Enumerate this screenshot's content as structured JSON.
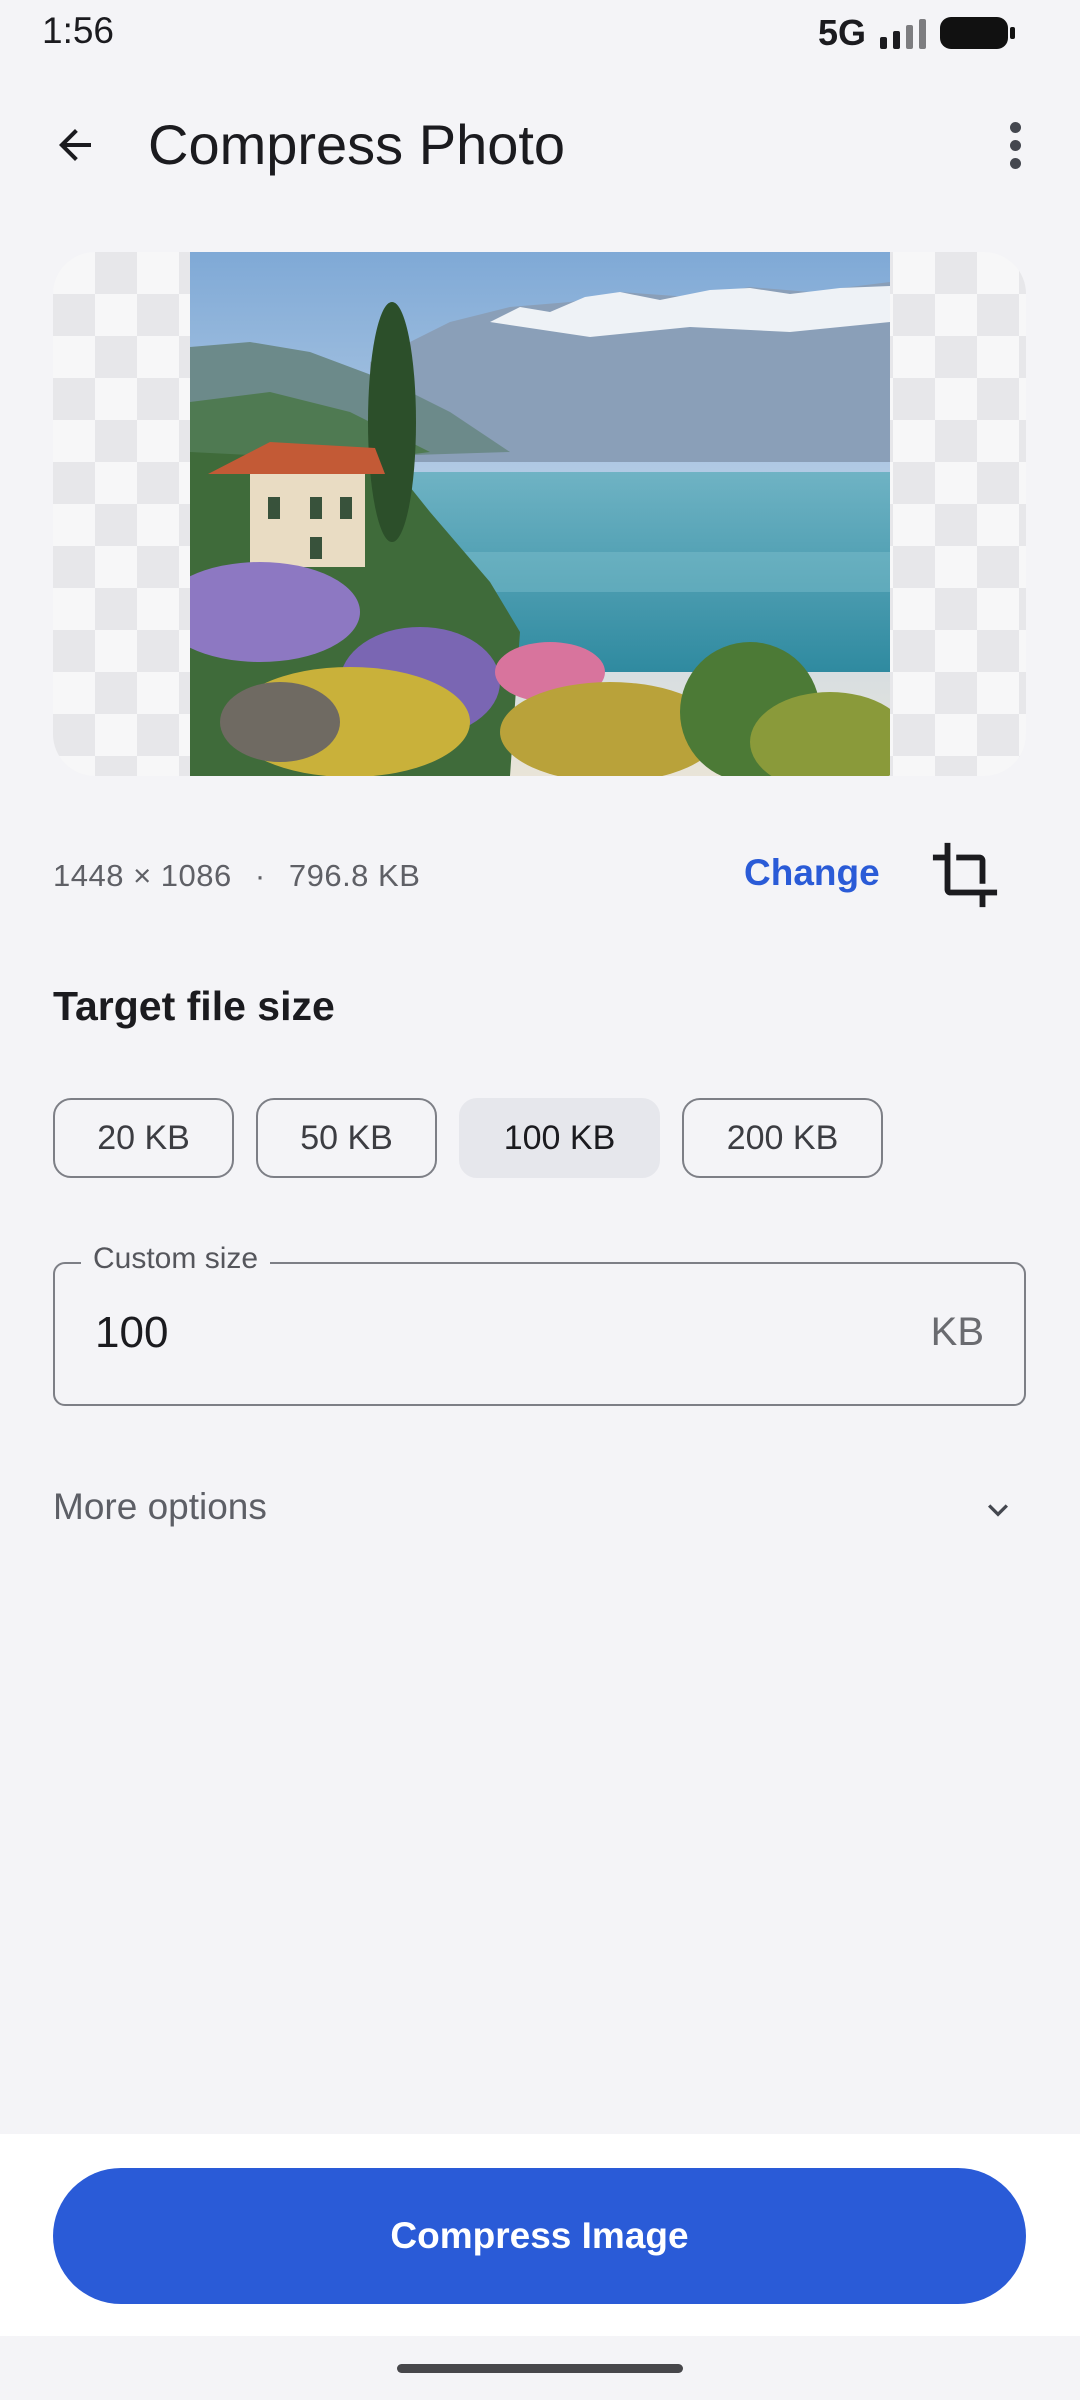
{
  "status_bar": {
    "time": "1:56",
    "network": "5G"
  },
  "app_bar": {
    "title": "Compress Photo",
    "back_icon": "arrow-back-icon",
    "menu_icon": "more-vert-icon"
  },
  "image_info": {
    "dimensions": "1448 × 1086",
    "separator": "·",
    "size": "796.8 KB",
    "change_label": "Change",
    "crop_icon": "crop-icon"
  },
  "target": {
    "title": "Target file size",
    "presets": [
      {
        "label": "20 KB",
        "selected": false
      },
      {
        "label": "50 KB",
        "selected": false
      },
      {
        "label": "100 KB",
        "selected": true
      },
      {
        "label": "200 KB",
        "selected": false
      }
    ]
  },
  "custom_size": {
    "label": "Custom size",
    "value": "100",
    "unit": "KB"
  },
  "more_options": {
    "label": "More options",
    "icon": "chevron-down-icon"
  },
  "action": {
    "compress_label": "Compress Image"
  },
  "colors": {
    "accent": "#2a5bd7",
    "background": "#f4f4f7",
    "chip_selected": "#e6e7ec"
  }
}
